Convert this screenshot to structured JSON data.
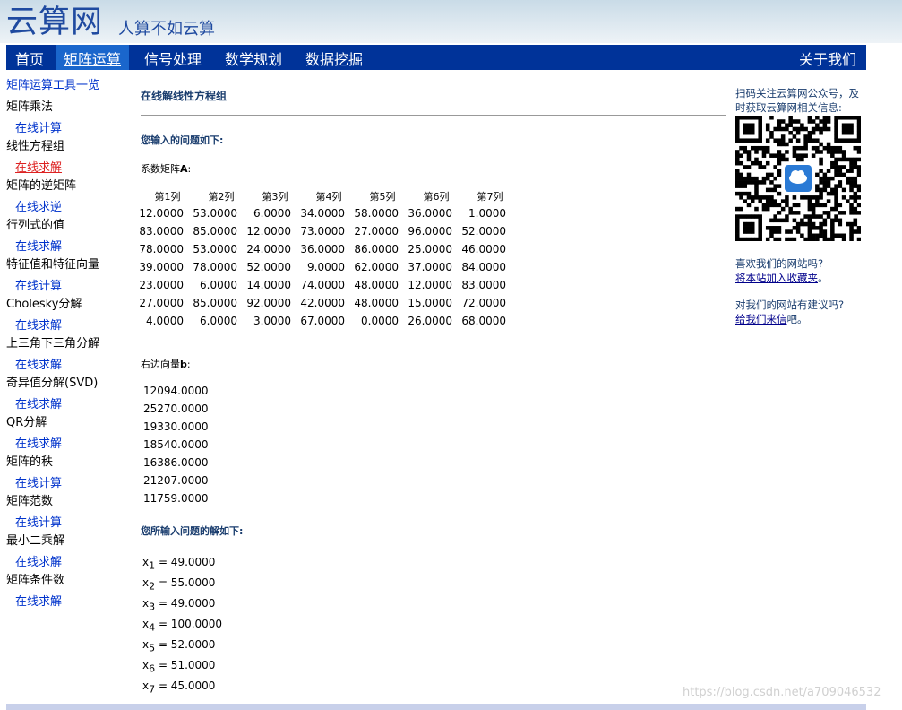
{
  "header": {
    "logo": "云算网",
    "slogan": "人算不如云算"
  },
  "nav": {
    "items": [
      {
        "label": "首页"
      },
      {
        "label": "矩阵运算"
      },
      {
        "label": "信号处理"
      },
      {
        "label": "数学规划"
      },
      {
        "label": "数据挖掘"
      }
    ],
    "about": "关于我们"
  },
  "sidebar": {
    "title": "矩阵运算工具一览",
    "groups": [
      {
        "label": "矩阵乘法",
        "link": "在线计算"
      },
      {
        "label": "线性方程组",
        "link": "在线求解"
      },
      {
        "label": "矩阵的逆矩阵",
        "link": "在线求逆"
      },
      {
        "label": "行列式的值",
        "link": "在线求解"
      },
      {
        "label": "特征值和特征向量",
        "link": "在线计算"
      },
      {
        "label": "Cholesky分解",
        "link": "在线求解"
      },
      {
        "label": "上三角下三角分解",
        "link": "在线求解"
      },
      {
        "label": "奇异值分解(SVD)",
        "link": "在线求解"
      },
      {
        "label": "QR分解",
        "link": "在线求解"
      },
      {
        "label": "矩阵的秩",
        "link": "在线计算"
      },
      {
        "label": "矩阵范数",
        "link": "在线计算"
      },
      {
        "label": "最小二乘解",
        "link": "在线求解"
      },
      {
        "label": "矩阵条件数",
        "link": "在线求解"
      }
    ]
  },
  "main": {
    "title": "在线解线性方程组",
    "input_heading": "您输入的问题如下:",
    "matrix_label_prefix": "系数矩阵",
    "matrix_label_var": "A",
    "matrix_label_suffix": ":",
    "matrix_headers": [
      "第1列",
      "第2列",
      "第3列",
      "第4列",
      "第5列",
      "第6列",
      "第7列"
    ],
    "matrix_rows": [
      [
        "12.0000",
        "53.0000",
        "6.0000",
        "34.0000",
        "58.0000",
        "36.0000",
        "1.0000"
      ],
      [
        "83.0000",
        "85.0000",
        "12.0000",
        "73.0000",
        "27.0000",
        "96.0000",
        "52.0000"
      ],
      [
        "78.0000",
        "53.0000",
        "24.0000",
        "36.0000",
        "86.0000",
        "25.0000",
        "46.0000"
      ],
      [
        "39.0000",
        "78.0000",
        "52.0000",
        "9.0000",
        "62.0000",
        "37.0000",
        "84.0000"
      ],
      [
        "23.0000",
        "6.0000",
        "14.0000",
        "74.0000",
        "48.0000",
        "12.0000",
        "83.0000"
      ],
      [
        "27.0000",
        "85.0000",
        "92.0000",
        "42.0000",
        "48.0000",
        "15.0000",
        "72.0000"
      ],
      [
        "4.0000",
        "6.0000",
        "3.0000",
        "67.0000",
        "0.0000",
        "26.0000",
        "68.0000"
      ]
    ],
    "vector_label_prefix": "右边向量",
    "vector_label_var": "b",
    "vector_label_suffix": ":",
    "vector_b": [
      "12094.0000",
      "25270.0000",
      "19330.0000",
      "18540.0000",
      "16386.0000",
      "21207.0000",
      "11759.0000"
    ],
    "solution_heading": "您所输入问题的解如下:",
    "solution": [
      {
        "var": "x",
        "sub": "1",
        "value": "= 49.0000"
      },
      {
        "var": "x",
        "sub": "2",
        "value": "= 55.0000"
      },
      {
        "var": "x",
        "sub": "3",
        "value": "= 49.0000"
      },
      {
        "var": "x",
        "sub": "4",
        "value": "= 100.0000"
      },
      {
        "var": "x",
        "sub": "5",
        "value": "= 52.0000"
      },
      {
        "var": "x",
        "sub": "6",
        "value": "= 51.0000"
      },
      {
        "var": "x",
        "sub": "7",
        "value": "= 45.0000"
      }
    ]
  },
  "right": {
    "qr_text": "扫码关注云算网公众号，及时获取云算网相关信息:",
    "like_question": "喜欢我们的网站吗?",
    "bookmark_link": "将本站加入收藏夹",
    "bookmark_suffix": "。",
    "suggest_question": "对我们的网站有建议吗?",
    "mail_link": "给我们来信",
    "mail_suffix": "吧。"
  },
  "watermark": "https://blog.csdn.net/a709046532"
}
